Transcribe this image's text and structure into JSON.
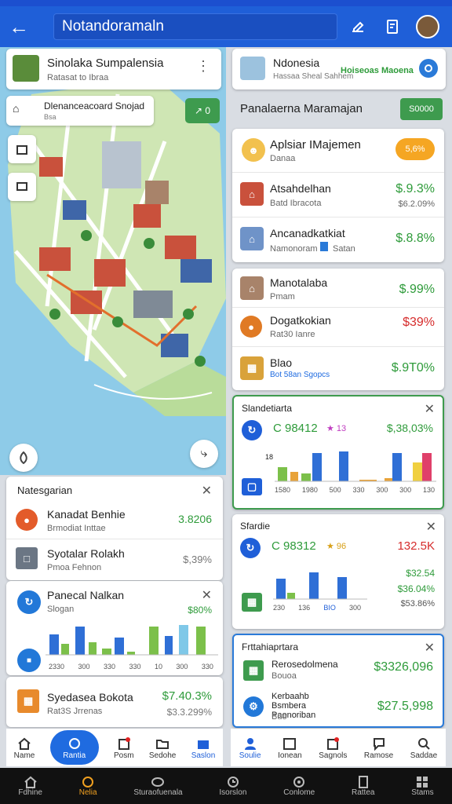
{
  "appbar": {
    "search_value": "Notandoramaln"
  },
  "left": {
    "place_card": {
      "title": "Sinolaka Sumpalensia",
      "subtitle": "Ratasat to Ibraa"
    },
    "map_popup": {
      "title": "Dlenanceacoard Snojad",
      "subtitle": "Bsa"
    },
    "map_badge": "↗ 0",
    "list_title": "Natesgarian",
    "rows": [
      {
        "title": "Kanadat Benhie",
        "sub": "Brmodiat Inttae",
        "value": "3.8206"
      },
      {
        "title": "Syotalar Rolakh",
        "sub": "Pmoa Fehnon",
        "value": "$,39%"
      }
    ],
    "chart_card": {
      "title": "Panecal Nalkan",
      "sub": "Slogan",
      "value": "$80%",
      "x_labels": [
        "2330",
        "300",
        "330",
        "330",
        "10",
        "300",
        "330"
      ]
    },
    "bottom_row": {
      "title": "Syedasea Bokota",
      "sub": "Rat3S Jrrenas",
      "value": "$7.40.3%",
      "value2": "$3.3.299%"
    },
    "nav": [
      {
        "icon": "home-icon",
        "label": "Name"
      },
      {
        "icon": "search-icon",
        "label": "Rantia"
      },
      {
        "icon": "bell-icon",
        "label": "Posm"
      },
      {
        "icon": "folder-icon",
        "label": "Sedohe"
      },
      {
        "icon": "bag-icon",
        "label": "Saslon"
      }
    ]
  },
  "right": {
    "header_card": {
      "title": "Ndonesia",
      "subtitle": "Hassaa Sheal Sahhem",
      "right_text": "Hoiseoas Maoena"
    },
    "section_title": "Panalaerna Maramajan",
    "section_button": "S0000",
    "agent": {
      "title": "Aplsiar IMajemen",
      "sub": "Danaa",
      "badge": "5,6%"
    },
    "list1": [
      {
        "title": "Atsahdelhan",
        "sub": "Batd Ibracota",
        "value": "$.9.3%",
        "value2": "$6.2.09%"
      },
      {
        "title": "Ancanadkatkiat",
        "sub": "Namonoram",
        "sub2": "Satan",
        "value": "$.8.8%"
      }
    ],
    "list2": [
      {
        "title": "Manotalaba",
        "sub": "Pmam",
        "value": "$.99%"
      },
      {
        "title": "Dogatkokian",
        "sub": "Rat30 Ianre",
        "value": "$39%"
      },
      {
        "title": "Blao",
        "sub": "Bot 58an Sgopcs",
        "value": "$.9T0%"
      }
    ],
    "chart1": {
      "title": "Slandetiarta",
      "num": "C 98412",
      "star": "★ 13",
      "value": "$,38,03%",
      "x_labels": [
        "1580",
        "1980",
        "500",
        "330",
        "300",
        "300",
        "130"
      ]
    },
    "chart2": {
      "title": "Sfardie",
      "num": "C 98312",
      "star": "★ 96",
      "value": "132.5K",
      "value2": "$32.54",
      "value3": "$36.04%",
      "value4": "$53.86%",
      "x_labels": [
        "230",
        "136",
        "BIO",
        "300"
      ]
    },
    "summary": {
      "title": "Frttahiaprtara",
      "rows": [
        {
          "title": "Rerosedolmena",
          "sub": "Bouoa",
          "value": "$3326,096"
        },
        {
          "title": "Kerbaahb Bsmbera Paonoriban",
          "sub": "Buo",
          "value": "$27.5,998"
        }
      ]
    },
    "nav": [
      {
        "icon": "user-icon",
        "label": "Soulie"
      },
      {
        "icon": "calendar-icon",
        "label": "Ionean"
      },
      {
        "icon": "bell-icon",
        "label": "Sagnols"
      },
      {
        "icon": "chat-icon",
        "label": "Ramose"
      },
      {
        "icon": "search-icon",
        "label": "Saddae"
      }
    ]
  },
  "sysbar": [
    {
      "icon": "home-icon",
      "label": "Fdhine"
    },
    {
      "icon": "compass-icon",
      "label": "Nelia"
    },
    {
      "icon": "coin-icon",
      "label": "Sturaofuenala"
    },
    {
      "icon": "clock-icon",
      "label": "Isorslon"
    },
    {
      "icon": "target-icon",
      "label": "Conlome"
    },
    {
      "icon": "doc-icon",
      "label": "Rattea"
    },
    {
      "icon": "grid-icon",
      "label": "Stams"
    }
  ]
}
